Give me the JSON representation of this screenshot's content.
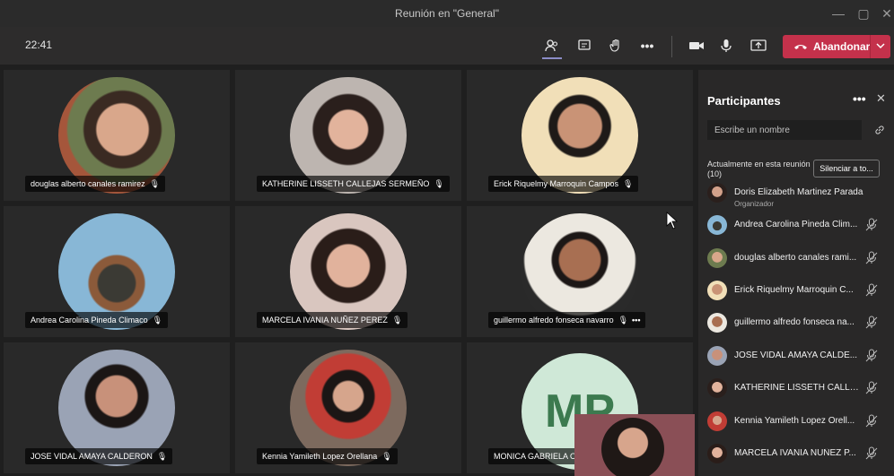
{
  "window": {
    "title": "Reunión en \"General\""
  },
  "toolbar": {
    "time": "22:41",
    "icons": [
      "participants-icon",
      "chat-icon",
      "raise-hand-icon",
      "more-icon",
      "camera-icon",
      "mic-icon",
      "share-screen-icon"
    ],
    "leave_label": "Abandonar"
  },
  "tiles": [
    {
      "name": "douglas alberto canales ramirez"
    },
    {
      "name": "KATHERINE LISSETH CALLEJAS SERMEÑO"
    },
    {
      "name": "Erick Riquelmy Marroquin Campos"
    },
    {
      "name": "Andrea Carolina Pineda Climaco"
    },
    {
      "name": "MARCELA IVANIA NUÑEZ PEREZ"
    },
    {
      "name": "guillermo alfredo fonseca navarro"
    },
    {
      "name": "JOSE VIDAL AMAYA CALDERON"
    },
    {
      "name": "Kennia Yamileth Lopez Orellana"
    },
    {
      "name": "MONICA GABRIELA ORE",
      "initials": "MP"
    }
  ],
  "panel": {
    "title": "Participantes",
    "search_placeholder": "Escribe un nombre",
    "section_label": "Actualmente en esta reunión (10)",
    "mute_all_label": "Silenciar a to...",
    "participants": [
      {
        "name": "Doris Elizabeth Martinez Parada",
        "role": "Organizador"
      },
      {
        "name": "Andrea Carolina Pineda Clim..."
      },
      {
        "name": "douglas alberto canales rami..."
      },
      {
        "name": "Erick Riquelmy Marroquin C..."
      },
      {
        "name": "guillermo alfredo fonseca na..."
      },
      {
        "name": "JOSE VIDAL AMAYA CALDE..."
      },
      {
        "name": "KATHERINE LISSETH CALLEJ..."
      },
      {
        "name": "Kennia Yamileth Lopez Orell..."
      },
      {
        "name": "MARCELA IVANIA NUÑEZ P..."
      }
    ]
  },
  "colors": {
    "accent": "#8b8cc7",
    "leave": "#c4314b",
    "background": "#1f1f1f"
  }
}
